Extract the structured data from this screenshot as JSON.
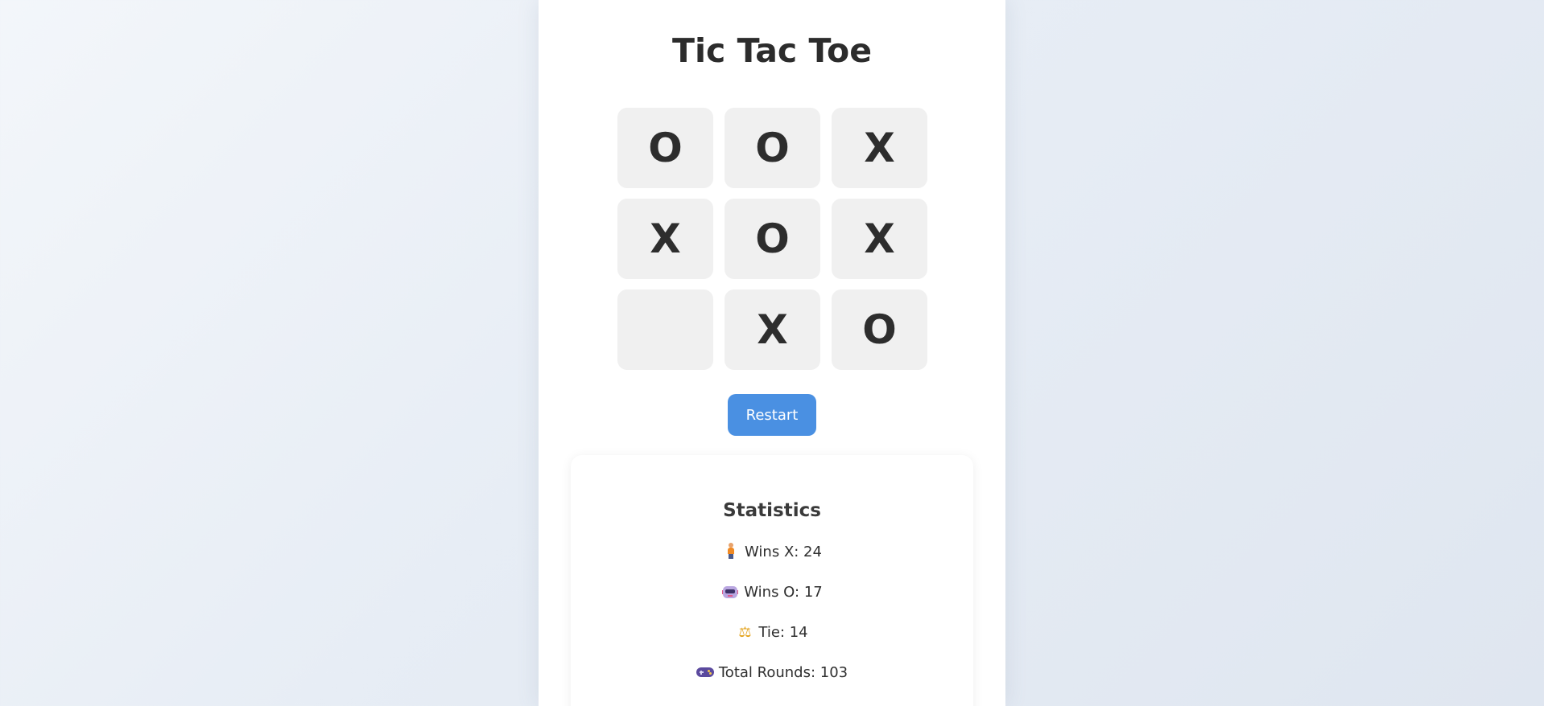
{
  "game": {
    "title": "Tic Tac Toe",
    "board": [
      "O",
      "O",
      "X",
      "X",
      "O",
      "X",
      "",
      "X",
      "O"
    ],
    "restart_label": "Restart"
  },
  "stats": {
    "title": "Statistics",
    "wins_x": {
      "icon": "person-icon",
      "text": "Wins X: 24"
    },
    "wins_o": {
      "icon": "robot-icon",
      "text": "Wins O: 17"
    },
    "tie": {
      "icon": "balance-scale-icon",
      "text": "Tie: 14"
    },
    "total_rounds": {
      "icon": "gamepad-icon",
      "text": "Total Rounds: 103"
    }
  },
  "colors": {
    "accent": "#4a90e2",
    "cell_bg": "#f0f0f0",
    "text": "#2c2c2c"
  }
}
